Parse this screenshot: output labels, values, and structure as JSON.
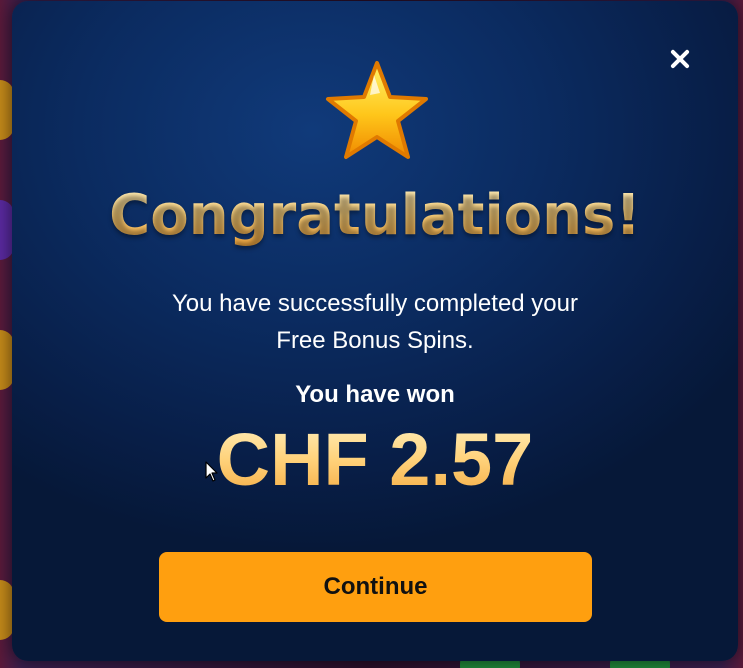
{
  "modal": {
    "title": "Congratulations!",
    "message_line1": "You have successfully completed your",
    "message_line2": "Free Bonus Spins.",
    "won_label": "You have won",
    "amount": "CHF 2.57",
    "continue_label": "Continue"
  },
  "icons": {
    "close": "close-icon",
    "star": "star-icon",
    "cursor": "mouse-cursor-icon"
  },
  "colors": {
    "modal_background": "#0b2b60",
    "title_gold": "#ffd27a",
    "button": "#ff9f0f",
    "button_text": "#111111"
  }
}
